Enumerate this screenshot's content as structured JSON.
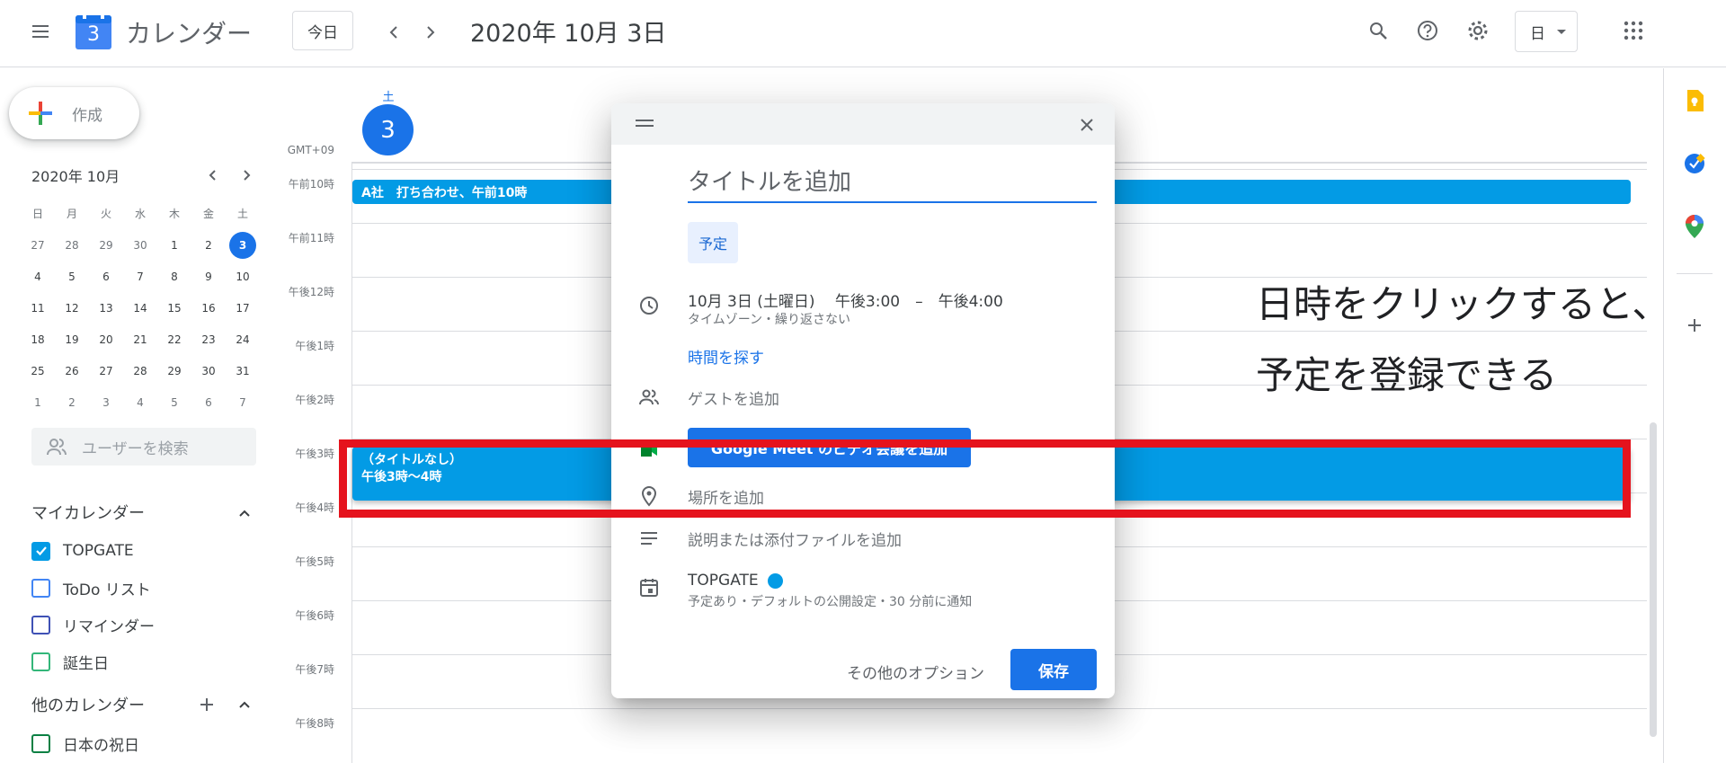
{
  "header": {
    "app_name": "カレンダー",
    "logo_day": "3",
    "today_label": "今日",
    "date_title": "2020年 10月 3日",
    "view_label": "日"
  },
  "sidebar": {
    "create_label": "作成",
    "mini_month": "2020年 10月",
    "weekdays": [
      "日",
      "月",
      "火",
      "水",
      "木",
      "金",
      "土"
    ],
    "weeks": [
      [
        "27",
        "28",
        "29",
        "30",
        "1",
        "2",
        "3"
      ],
      [
        "4",
        "5",
        "6",
        "7",
        "8",
        "9",
        "10"
      ],
      [
        "11",
        "12",
        "13",
        "14",
        "15",
        "16",
        "17"
      ],
      [
        "18",
        "19",
        "20",
        "21",
        "22",
        "23",
        "24"
      ],
      [
        "25",
        "26",
        "27",
        "28",
        "29",
        "30",
        "31"
      ],
      [
        "1",
        "2",
        "3",
        "4",
        "5",
        "6",
        "7"
      ]
    ],
    "selected_day": "3",
    "search_placeholder": "ユーザーを検索",
    "my_calendars_title": "マイカレンダー",
    "my_calendars": [
      {
        "label": "TOPGATE",
        "color": "#039be5",
        "checked": true
      },
      {
        "label": "ToDo リスト",
        "color": "#4285f4",
        "checked": false
      },
      {
        "label": "リマインダー",
        "color": "#3f51b5",
        "checked": false
      },
      {
        "label": "誕生日",
        "color": "#33b679",
        "checked": false
      }
    ],
    "other_calendars_title": "他のカレンダー",
    "other_calendars": [
      {
        "label": "日本の祝日",
        "color": "#0b8043",
        "checked": false
      }
    ]
  },
  "day_view": {
    "weekday": "土",
    "day_number": "3",
    "timezone": "GMT+09",
    "time_labels": [
      "午前10時",
      "午前11時",
      "午後12時",
      "午後1時",
      "午後2時",
      "午後3時",
      "午後4時",
      "午後5時",
      "午後6時",
      "午後7時",
      "午後8時"
    ],
    "events": [
      {
        "title": "A社　打ち合わせ、午前10時"
      },
      {
        "title": "（タイトルなし）",
        "time": "午後3時～4時"
      }
    ]
  },
  "dialog": {
    "title_placeholder": "タイトルを追加",
    "type_chip": "予定",
    "datetime": "10月 3日 (土曜日)　 午後3:00　–　午後4:00",
    "datetime_sub": "タイムゾーン・繰り返さない",
    "find_time": "時間を探す",
    "add_guests": "ゲストを追加",
    "meet_button": "Google Meet のビデオ会議を追加",
    "add_location": "場所を追加",
    "add_description": "説明または添付ファイルを追加",
    "calendar_name": "TOPGATE",
    "calendar_color": "#039be5",
    "calendar_sub": "予定あり・デフォルトの公開設定・30 分前に通知",
    "more_options": "その他のオプション",
    "save": "保存"
  },
  "annotation": {
    "line1": "日時をクリックすると、",
    "line2": "予定を登録できる",
    "box_color": "#e5131d"
  }
}
